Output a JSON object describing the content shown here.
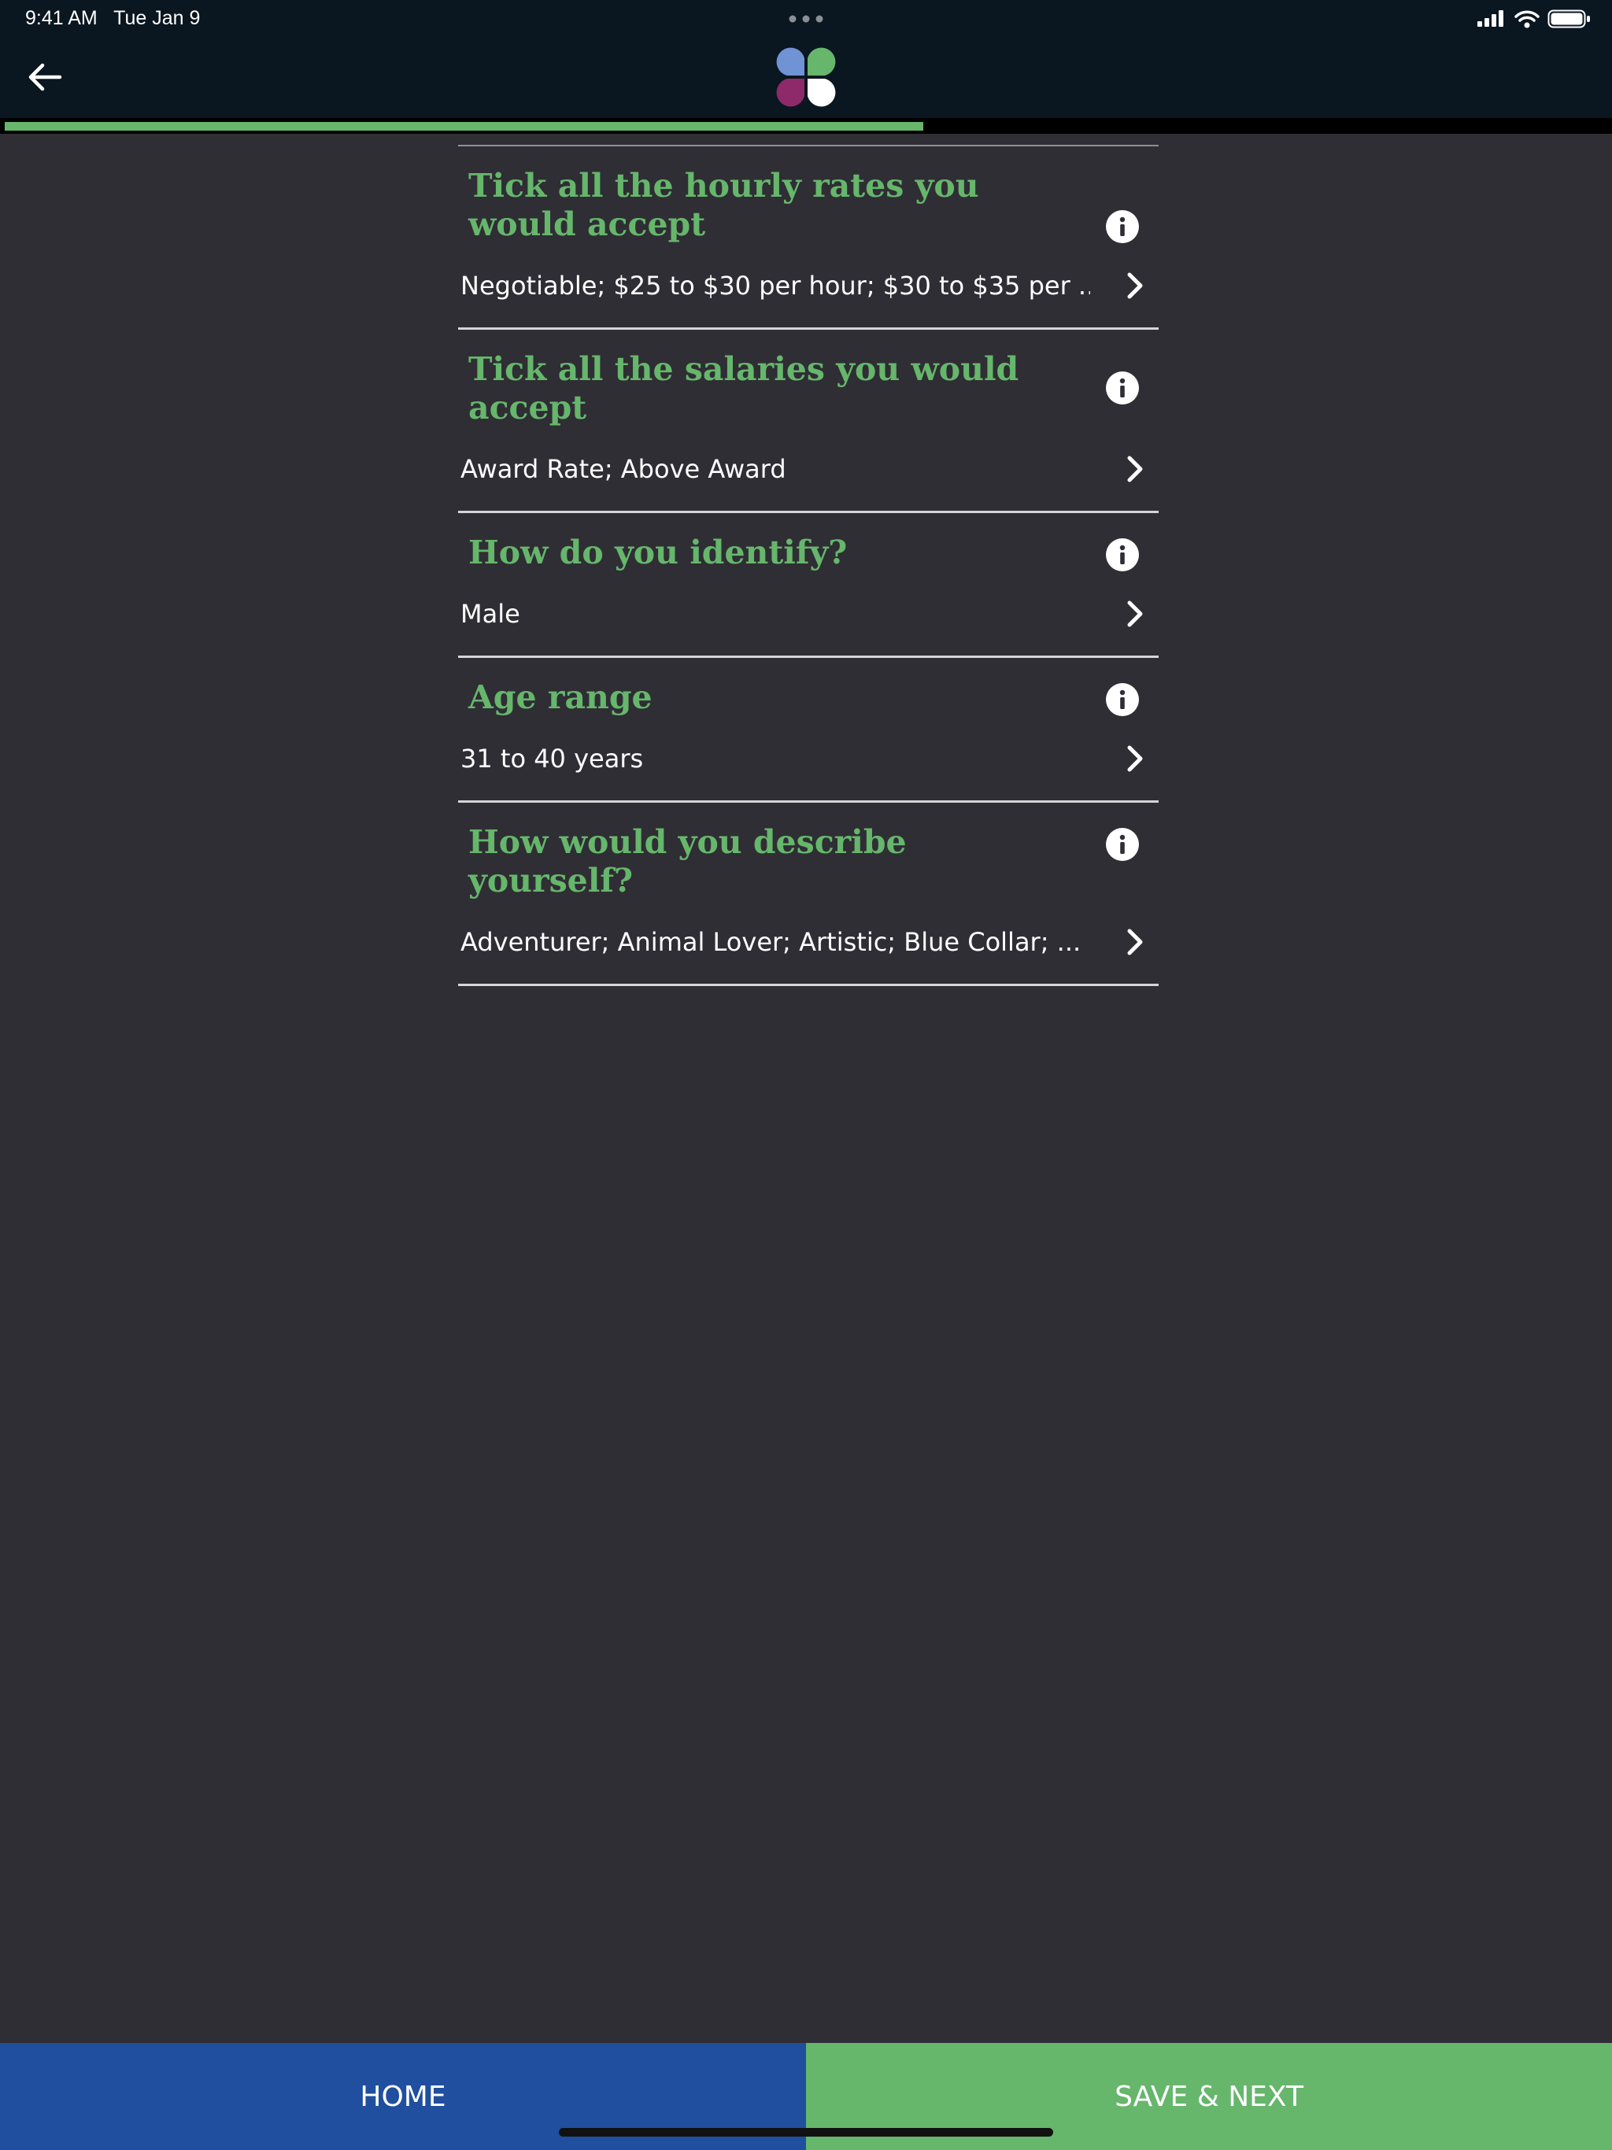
{
  "status_bar": {
    "time": "9:41 AM",
    "date": "Tue Jan 9",
    "icons": [
      "signal-icon",
      "wifi-icon",
      "battery-icon"
    ]
  },
  "nav": {
    "back_icon": "arrow-left-icon",
    "logo": "clover-logo",
    "progress": 0.57
  },
  "questions": [
    {
      "title": "Tick all the hourly rates you would accept",
      "answer": "Negotiable; $25 to $30 per hour; $30 to $35 per ..."
    },
    {
      "title": "Tick all the salaries you would accept",
      "answer": "Award Rate; Above Award"
    },
    {
      "title": "How do you identify?",
      "answer": "Male"
    },
    {
      "title": "Age range",
      "answer": "31 to 40 years"
    },
    {
      "title": "How would you describe yourself?",
      "answer": "Adventurer; Animal Lover; Artistic; Blue Collar; ..."
    }
  ],
  "footer": {
    "home_label": "HOME",
    "next_label": "SAVE & NEXT"
  },
  "colors": {
    "accent_green": "#66b66c",
    "home_blue": "#1f4f9e",
    "background": "#2f2e34",
    "header": "#0a1620"
  }
}
